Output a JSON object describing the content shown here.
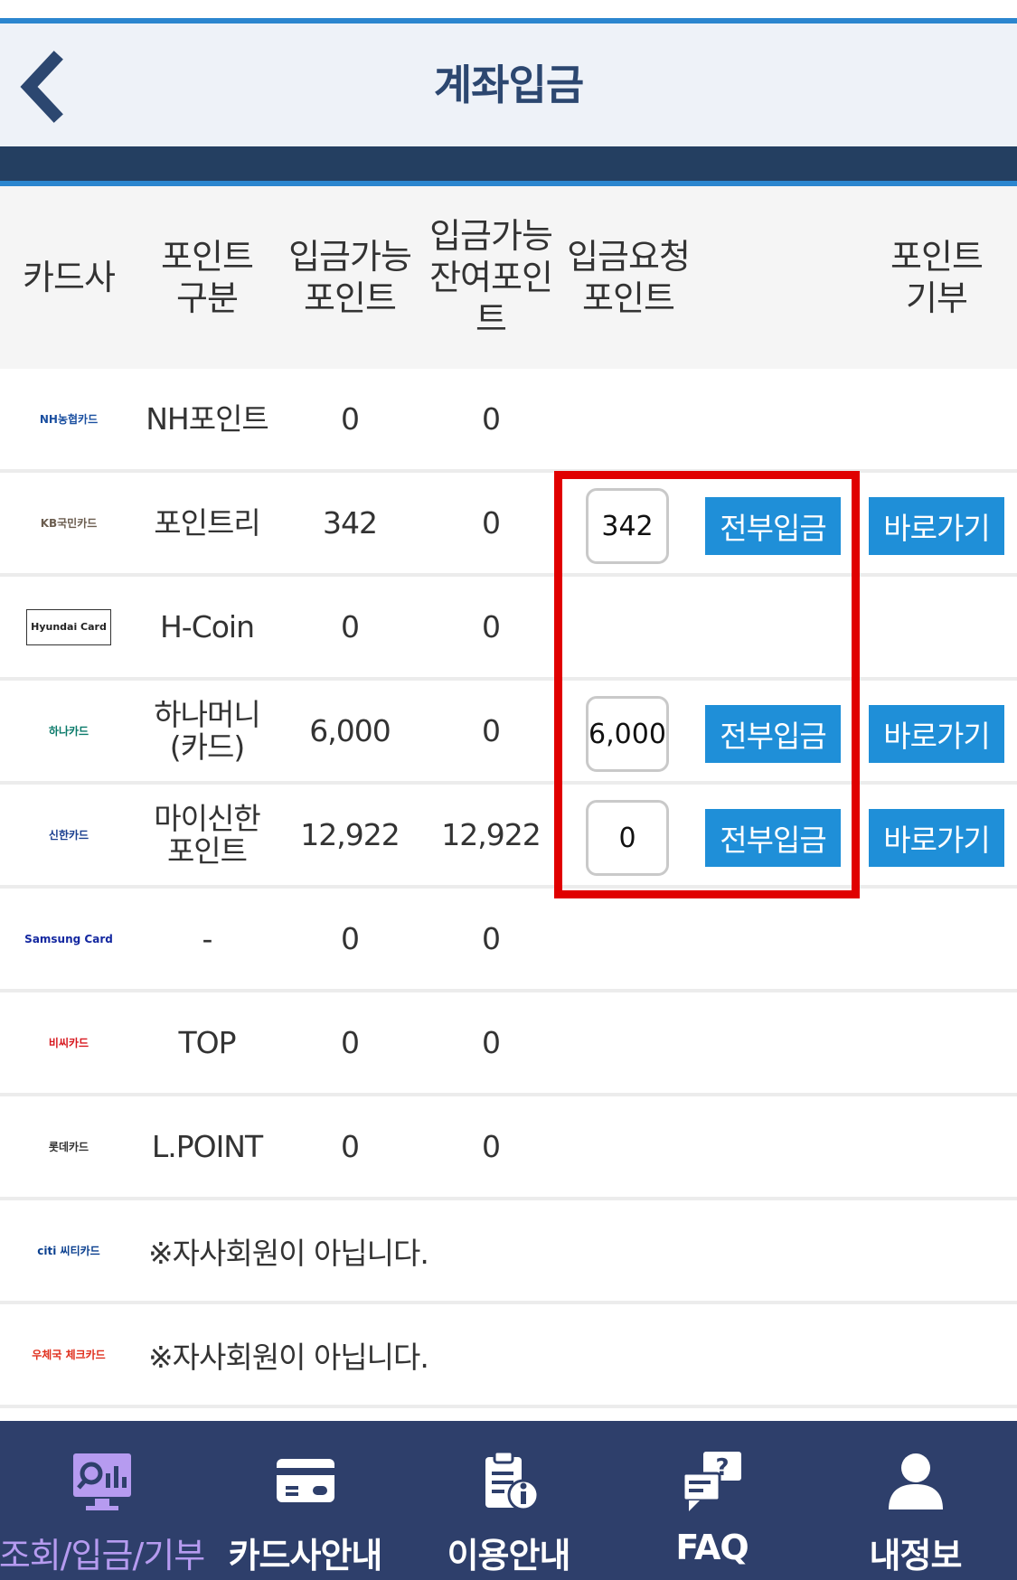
{
  "header": {
    "title": "계좌입금",
    "back_icon": "chevron-left-icon"
  },
  "table": {
    "headers": [
      [
        "카드사"
      ],
      [
        "포인트",
        "구분"
      ],
      [
        "입금가능",
        "포인트"
      ],
      [
        "입금가능",
        "잔여포인",
        "트"
      ],
      [
        "입금요청",
        "포인트"
      ],
      [
        "포인트",
        "기부"
      ]
    ],
    "rows": [
      {
        "logo": "NH농협카드",
        "type": [
          "NH포인트"
        ],
        "available": "0",
        "remaining": "0"
      },
      {
        "logo": "KB국민카드",
        "type": [
          "포인트리"
        ],
        "available": "342",
        "remaining": "0",
        "request": "342",
        "deposit_all": "전부입금",
        "donate": "바로가기"
      },
      {
        "logo": "Hyundai Card",
        "type": [
          "H-Coin"
        ],
        "available": "0",
        "remaining": "0"
      },
      {
        "logo": "하나카드",
        "type": [
          "하나머니",
          "(카드)"
        ],
        "available": "6,000",
        "remaining": "0",
        "request": "6,000",
        "deposit_all": "전부입금",
        "donate": "바로가기"
      },
      {
        "logo": "신한카드",
        "type": [
          "마이신한",
          "포인트"
        ],
        "available": "12,922",
        "remaining": "12,922",
        "request": "0",
        "deposit_all": "전부입금",
        "donate": "바로가기"
      },
      {
        "logo": "Samsung Card",
        "type": [
          "-"
        ],
        "available": "0",
        "remaining": "0"
      },
      {
        "logo": "비씨카드",
        "type": [
          "TOP"
        ],
        "available": "0",
        "remaining": "0"
      },
      {
        "logo": "롯데카드",
        "type": [
          "L.POINT"
        ],
        "available": "0",
        "remaining": "0"
      },
      {
        "logo": "citi 씨티카드",
        "message": "※자사회원이 아닙니다."
      },
      {
        "logo": "우체국 체크카드",
        "message": "※자사회원이 아닙니다."
      }
    ]
  },
  "colors": {
    "accent": "#1f8fd8",
    "highlight": "#e00000",
    "nav_bg": "#2e3f6b",
    "header_navy": "#243f61",
    "active_nav": "#b69bf0"
  },
  "bottom_nav": [
    {
      "label": "조회/입금/기부",
      "icon": "chart-search-icon",
      "active": true
    },
    {
      "label": "카드사안내",
      "icon": "credit-card-icon",
      "active": false
    },
    {
      "label": "이용안내",
      "icon": "clipboard-info-icon",
      "active": false
    },
    {
      "label": "FAQ",
      "icon": "faq-chat-icon",
      "active": false
    },
    {
      "label": "내정보",
      "icon": "user-icon",
      "active": false
    }
  ]
}
